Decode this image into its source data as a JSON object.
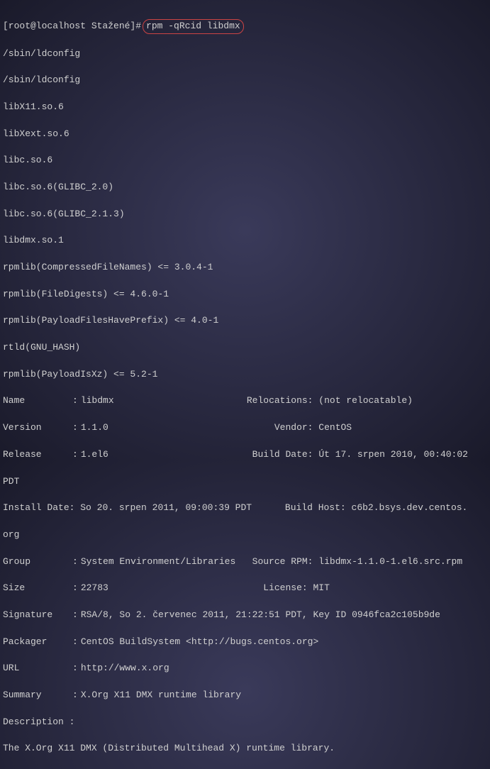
{
  "prompt": {
    "user_host": "[root@localhost Stažené]#",
    "command": "rpm -qRcid libdmx"
  },
  "deps": [
    "/sbin/ldconfig",
    "/sbin/ldconfig",
    "libX11.so.6",
    "libXext.so.6",
    "libc.so.6",
    "libc.so.6(GLIBC_2.0)",
    "libc.so.6(GLIBC_2.1.3)",
    "libdmx.so.1",
    "rpmlib(CompressedFileNames) <= 3.0.4-1",
    "rpmlib(FileDigests) <= 4.6.0-1",
    "rpmlib(PayloadFilesHavePrefix) <= 4.0-1",
    "rtld(GNU_HASH)",
    "rpmlib(PayloadIsXz) <= 5.2-1"
  ],
  "info": {
    "name_label": "Name",
    "name_value": "libdmx",
    "relocations_label": "Relocations:",
    "relocations_value": "(not relocatable)",
    "version_label": "Version",
    "version_value": "1.1.0",
    "vendor_label": "Vendor:",
    "vendor_value": "CentOS",
    "release_label": "Release",
    "release_value": "1.el6",
    "builddate_label": "Build Date:",
    "builddate_value": "Út 17. srpen 2010, 00:40:02 ",
    "builddate_tz": "PDT",
    "installdate_label": "Install Date:",
    "installdate_value": "So 20. srpen 2011, 09:00:39 PDT",
    "buildhost_label": "Build Host:",
    "buildhost_value": "c6b2.bsys.dev.centos.",
    "buildhost_wrap": "org",
    "group_label": "Group",
    "group_value": "System Environment/Libraries",
    "sourcerpm_label": "Source RPM:",
    "sourcerpm_value": "libdmx-1.1.0-1.el6.src.rpm",
    "size_label": "Size",
    "size_value": "22783",
    "license_label": "License:",
    "license_value": "MIT",
    "signature_label": "Signature",
    "signature_value": "RSA/8, So 2. červenec 2011, 21:22:51 PDT, Key ID 0946fca2c105b9de",
    "packager_label": "Packager",
    "packager_value": "CentOS BuildSystem <http://bugs.centos.org>",
    "url_label": "URL",
    "url_value": "http://www.x.org",
    "summary_label": "Summary",
    "summary_value": "X.Org X11 DMX runtime library",
    "description_label": "Description :",
    "description_value": "The X.Org X11 DMX (Distributed Multihead X) runtime library."
  }
}
